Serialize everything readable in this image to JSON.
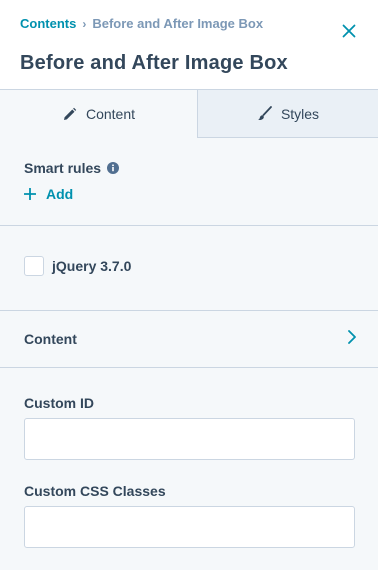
{
  "breadcrumb": {
    "parent": "Contents",
    "separator": "›",
    "current": "Before and After Image Box"
  },
  "header": {
    "title": "Before and After Image Box"
  },
  "tabs": [
    {
      "label": "Content",
      "icon": "pencil-icon",
      "active": true
    },
    {
      "label": "Styles",
      "icon": "brush-icon",
      "active": false
    }
  ],
  "smart_rules": {
    "label": "Smart rules",
    "add_label": "Add"
  },
  "jquery": {
    "label": "jQuery 3.7.0",
    "checked": false
  },
  "content_section": {
    "label": "Content"
  },
  "fields": {
    "custom_id": {
      "label": "Custom ID",
      "value": ""
    },
    "custom_css": {
      "label": "Custom CSS Classes",
      "value": ""
    }
  },
  "colors": {
    "accent": "#0091ae",
    "text": "#33475b",
    "muted": "#7c98b6",
    "border": "#cbd6e2",
    "panel_bg": "#f5f8fa",
    "inactive_tab_bg": "#eaf0f6"
  }
}
